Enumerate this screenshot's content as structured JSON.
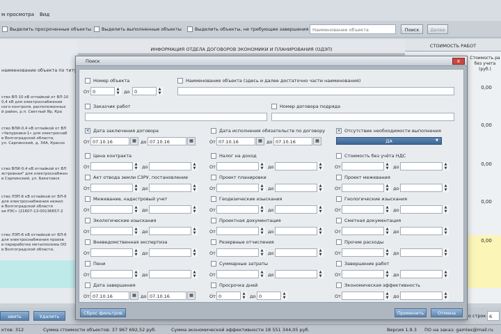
{
  "menu": {
    "items": [
      "м просмотра",
      "Вид"
    ]
  },
  "toolbar": {
    "cb1": "Выделить просроченные объекты",
    "cb2": "Выделить выполненные объекты",
    "cb3": "Выделить объекты, не требующие завершения",
    "search_placeholder": "Наименование объекта",
    "search_btn": "Поиск",
    "clear_btn": "Далее"
  },
  "grid": {
    "header": "ИНФОРМАЦИЯ ОТДЕЛА ДОГОВОРОВ ЭКОНОМИКИ И ПЛАНИРОВАНИЯ (ОДЭП)",
    "col_name": "наименование объекта по титул",
    "rows": [
      "ство ВЛ-10 кВ отпайкой от ВЛ-10",
      "0,4 кВ для электроснабжения",
      "ного контроля, расположенных",
      "й район, р.п. Светлый Яр, Кра",
      "ство ВЛИ-0,4 кВ отпайкой от ВЛ",
      "«Чапурники-1» для электроснаб",
      "в Волгоградской области,",
      "ул. Сарпинский, д. 34А, Красно",
      "ство ВЛИ-0,4 кВ отпайкой от ВЛ",
      "ястровная\" для электроснабжен",
      "в Сарпинский, ул. Бекетовск",
      "ство ЛЭП-6 кВ отпайкой от ВЛ-6",
      "для электроснабжения нежил",
      "в Волгоградской области",
      "ая РЭС» (21607-13-00136657-2",
      "ство ЛЭП-6 кВ отпайкой от ВЛ-6",
      "для электроснабжения произв",
      "в переработке металлолома ОО",
      "в Волгоградской области,"
    ],
    "right_header": "СТОИМОСТЬ РАБОТ",
    "right_col": "Стоимость ра без учета (руб.)",
    "right_values": [
      "0,00",
      "0,00",
      "0,00",
      "0,00",
      "0,00"
    ]
  },
  "bottom": {
    "add": "авить",
    "delete": "Удалить",
    "rows_label": "о строк",
    "rows_value": "6"
  },
  "status": {
    "count": "ктов: 312",
    "sum": "Сумма стоимости объектов: 37 967 692,52 руб.",
    "eff": "Сумма экономической эффективности 18 551 344,05 руб.",
    "version": "Версия 1.9.3",
    "order": "ПО на заказ: gamlex@mail.ru"
  },
  "dialog": {
    "title": "Поиск",
    "close": "x",
    "obj_num": "Номер объекта",
    "from": "От",
    "to": "до",
    "zero": "0",
    "obj_name": "Наименование объекта (здесь и далее достаточно части наименования)",
    "customer": "Заказчик работ",
    "contract_num": "Номер договора подряда",
    "date_sign": "Дата заключения договора",
    "date_exec": "Дата исполнения обязательств по договору",
    "no_completion": "Отсутствие необходимости выполнения",
    "yes": "ДА",
    "date": "07.10.16",
    "check": "✕",
    "fields": [
      "Цена контракта",
      "Налог на доход",
      "Стоимость без учёта НДС",
      "Акт отвода земли СЗРУ, постановление",
      "Проект планировки",
      "Проект межевания",
      "Межевание, кадастровый учет",
      "Геодезические изыскания",
      "Геологические изыскания",
      "Экологические изыскания",
      "Проектная документация",
      "Сметная документация",
      "Вневедомственная экспертиза",
      "Резервные отчисления",
      "Прочие расходы",
      "Пени",
      "Суммарные затраты",
      "Завершение работ",
      "Дата завершения",
      "Просрочка дней",
      "Экономическая эффективность"
    ],
    "reset": "Сброс фильтров",
    "apply": "Применить",
    "cancel": "Отмена"
  }
}
